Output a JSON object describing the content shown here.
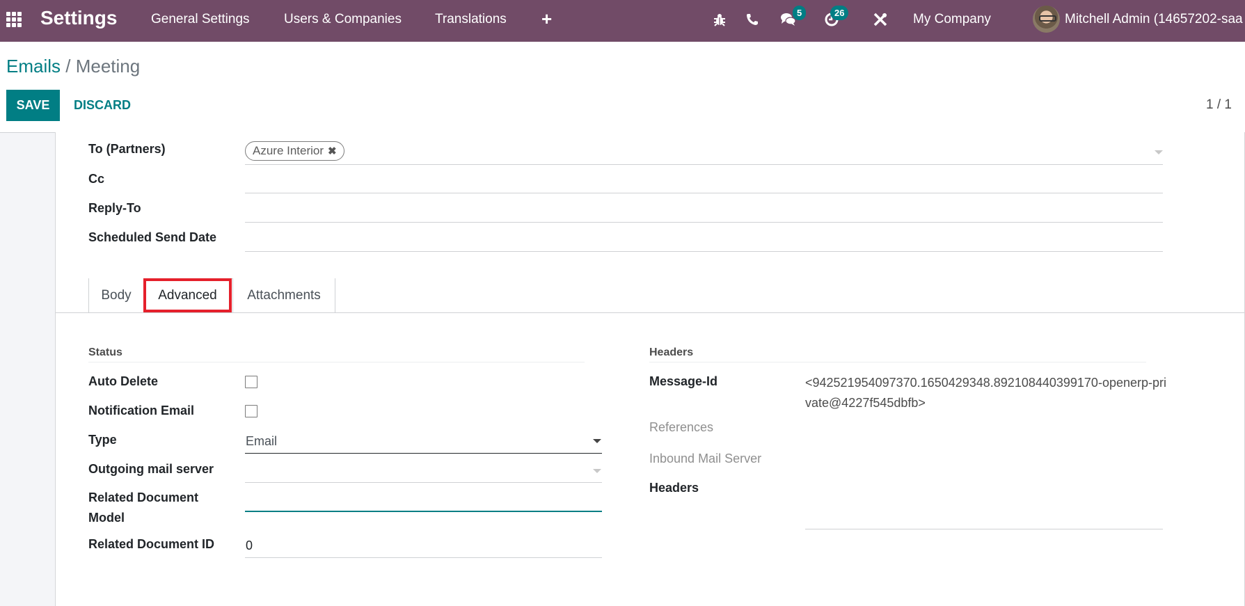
{
  "navbar": {
    "app_menu_icon": "grid-icon",
    "brand": "Settings",
    "menu_items": [
      "General Settings",
      "Users & Companies",
      "Translations"
    ],
    "add_icon": "plus-icon",
    "systray": {
      "debug_icon": "bug-icon",
      "phone_icon": "phone-icon",
      "messages_icon": "chat-icon",
      "messages_count": "5",
      "activities_icon": "clock-icon",
      "activities_count": "26",
      "tools_icon": "tools-icon",
      "company": "My Company",
      "user_name": "Mitchell Admin (14657202-saa"
    }
  },
  "control_panel": {
    "breadcrumb": {
      "parent": "Emails",
      "separator": "/",
      "current": "Meeting"
    },
    "save_label": "SAVE",
    "discard_label": "DISCARD",
    "pager": "1 / 1"
  },
  "form": {
    "to_partners": {
      "label": "To (Partners)",
      "tags": [
        {
          "name": "Azure Interior",
          "remove_icon": "close-icon"
        }
      ]
    },
    "cc": {
      "label": "Cc",
      "value": ""
    },
    "reply_to": {
      "label": "Reply-To",
      "value": ""
    },
    "scheduled_send_date": {
      "label": "Scheduled Send Date",
      "value": ""
    },
    "tabs": [
      {
        "label": "Body",
        "active": false
      },
      {
        "label": "Advanced",
        "active": true
      },
      {
        "label": "Attachments",
        "active": false
      }
    ],
    "highlight_color": "#e5202b",
    "status_group": {
      "title": "Status",
      "auto_delete": {
        "label": "Auto Delete",
        "checked": false
      },
      "notification_email": {
        "label": "Notification Email",
        "checked": false
      },
      "type": {
        "label": "Type",
        "value": "Email"
      },
      "outgoing_mail_server": {
        "label": "Outgoing mail server",
        "value": ""
      },
      "related_document_model": {
        "label_line1": "Related Document",
        "label_line2": "Model",
        "value": ""
      },
      "related_document_id": {
        "label": "Related Document ID",
        "value": "0"
      }
    },
    "headers_group": {
      "title": "Headers",
      "message_id": {
        "label": "Message-Id",
        "value": "<942521954097370.1650429348.892108440399170-openerp-private@4227f545dbfb>"
      },
      "references": {
        "label": "References",
        "value": ""
      },
      "inbound_mail_server": {
        "label": "Inbound Mail Server",
        "value": ""
      },
      "headers": {
        "label": "Headers",
        "value": ""
      }
    }
  },
  "colors": {
    "navbar": "#714B67",
    "primary": "#017e84",
    "badge": "#017e84"
  }
}
